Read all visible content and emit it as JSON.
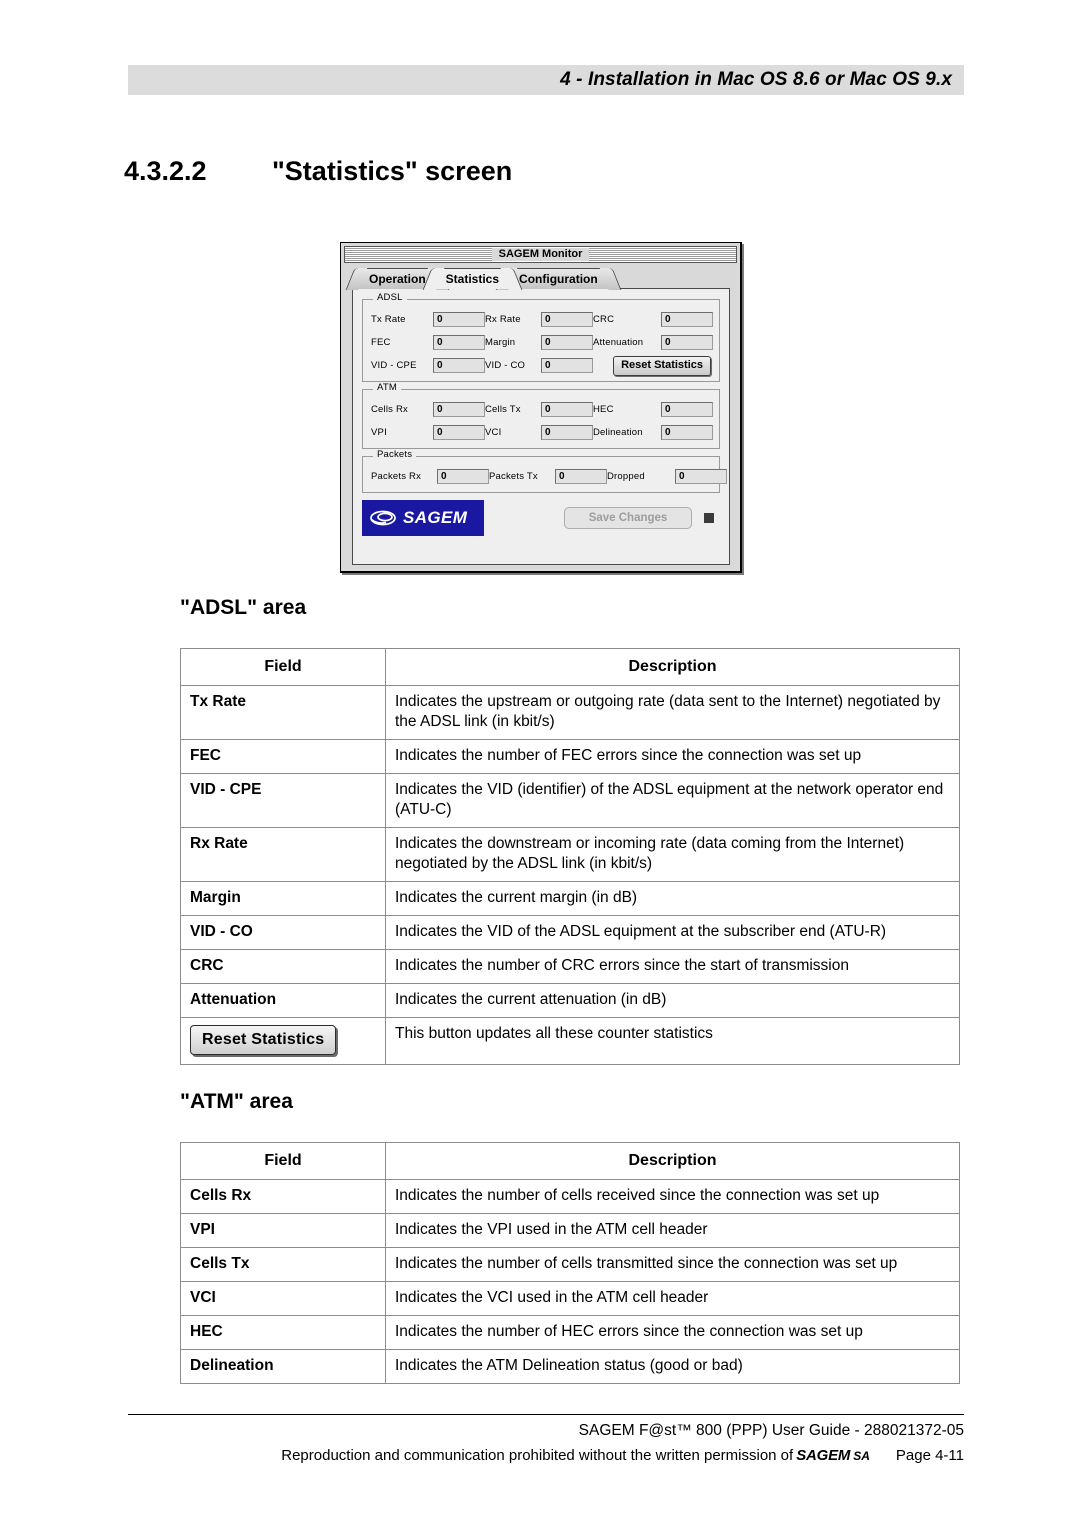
{
  "header": {
    "running_head": "4 - Installation in Mac OS 8.6 or Mac OS 9.x"
  },
  "section": {
    "number": "4.3.2.2",
    "title": "\"Statistics\" screen"
  },
  "monitor_window": {
    "title": "SAGEM Monitor",
    "tabs": [
      {
        "label": "Operation",
        "active": false
      },
      {
        "label": "Statistics",
        "active": true
      },
      {
        "label": "Configuration",
        "active": false
      }
    ],
    "adsl_group": {
      "legend": "ADSL",
      "fields": [
        {
          "label": "Tx Rate",
          "value": "0"
        },
        {
          "label": "Rx Rate",
          "value": "0"
        },
        {
          "label": "CRC",
          "value": "0"
        },
        {
          "label": "FEC",
          "value": "0"
        },
        {
          "label": "Margin",
          "value": "0"
        },
        {
          "label": "Attenuation",
          "value": "0"
        },
        {
          "label": "VID - CPE",
          "value": "0"
        },
        {
          "label": "VID - CO",
          "value": "0"
        }
      ],
      "reset_button": "Reset Statistics"
    },
    "atm_group": {
      "legend": "ATM",
      "fields": [
        {
          "label": "Cells Rx",
          "value": "0"
        },
        {
          "label": "Cells Tx",
          "value": "0"
        },
        {
          "label": "HEC",
          "value": "0"
        },
        {
          "label": "VPI",
          "value": "0"
        },
        {
          "label": "VCI",
          "value": "0"
        },
        {
          "label": "Delineation",
          "value": "0"
        }
      ]
    },
    "packets_group": {
      "legend": "Packets",
      "fields": [
        {
          "label": "Packets Rx",
          "value": "0"
        },
        {
          "label": "Packets Tx",
          "value": "0"
        },
        {
          "label": "Dropped",
          "value": "0"
        }
      ]
    },
    "logo_text": "SAGEM",
    "logo_color": "#1a18a0",
    "save_button": "Save Changes"
  },
  "adsl_area": {
    "title": "\"ADSL\" area",
    "columns": [
      "Field",
      "Description"
    ],
    "rows": [
      {
        "field": "Tx Rate",
        "description": "Indicates the upstream or outgoing rate (data sent to the Internet) negotiated by the ADSL link (in kbit/s)"
      },
      {
        "field": "FEC",
        "description": "Indicates the number of FEC errors since the connection was set up"
      },
      {
        "field": "VID - CPE",
        "description": "Indicates the VID (identifier) of the ADSL equipment at the network operator end (ATU-C)"
      },
      {
        "field": "Rx Rate",
        "description": "Indicates the downstream or incoming rate (data coming from the Internet) negotiated by the ADSL link (in kbit/s)"
      },
      {
        "field": "Margin",
        "description": "Indicates the current margin (in dB)"
      },
      {
        "field": "VID - CO",
        "description": "Indicates the VID of the ADSL equipment at the subscriber end (ATU-R)"
      },
      {
        "field": "CRC",
        "description": "Indicates the number of CRC errors since the start of transmission"
      },
      {
        "field": "Attenuation",
        "description": "Indicates the current attenuation (in dB)"
      },
      {
        "field": "Reset Statistics",
        "field_is_button": true,
        "description": "This button updates all these counter statistics"
      }
    ]
  },
  "atm_area": {
    "title": "\"ATM\" area",
    "columns": [
      "Field",
      "Description"
    ],
    "rows": [
      {
        "field": "Cells Rx",
        "description": "Indicates the number of cells received since the connection was set up"
      },
      {
        "field": "VPI",
        "description": "Indicates the VPI used in the ATM cell header"
      },
      {
        "field": "Cells Tx",
        "description": "Indicates the number of cells transmitted since the connection was set up"
      },
      {
        "field": "VCI",
        "description": "Indicates the VCI used in the ATM cell header"
      },
      {
        "field": "HEC",
        "description": "Indicates the number of HEC errors since the connection was set up"
      },
      {
        "field": "Delineation",
        "description": "Indicates the ATM Delineation status (good or bad)"
      }
    ]
  },
  "footer": {
    "line1": "SAGEM F@st™ 800 (PPP) User Guide - 288021372-05",
    "line2_prefix": "Reproduction and communication prohibited without the written permission of",
    "line2_sagem": "SAGEM",
    "line2_sa": "SA",
    "page": "Page 4-11"
  }
}
